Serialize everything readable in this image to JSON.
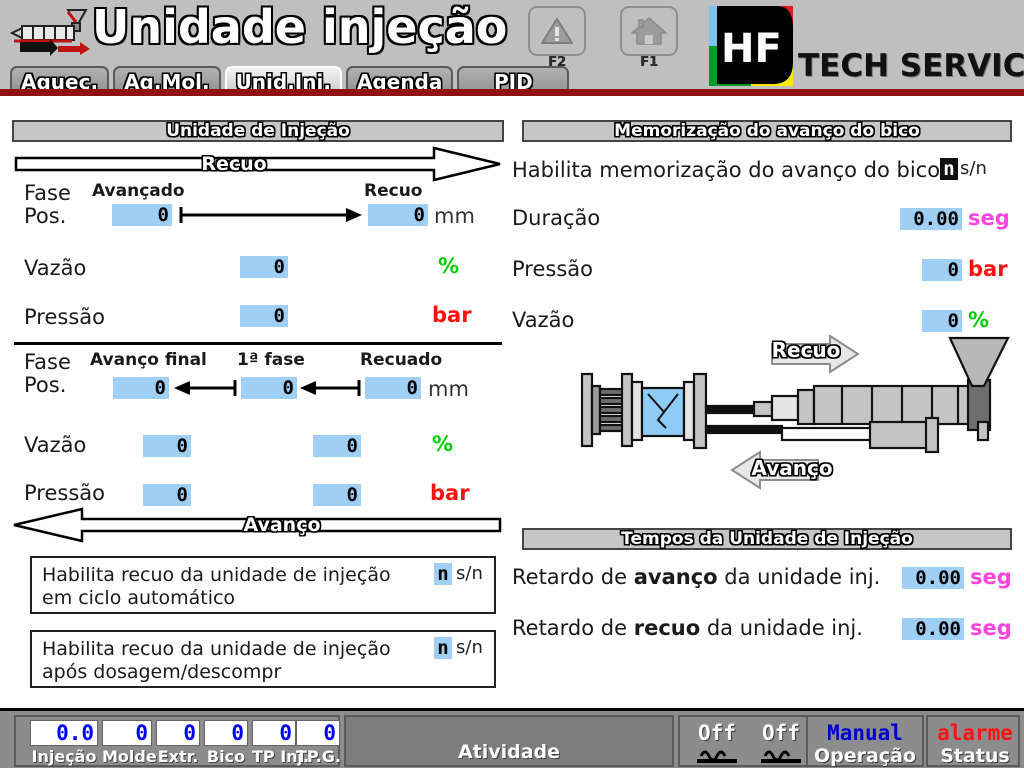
{
  "header": {
    "title": "Unidade injeção",
    "title_icon": "injection-unit-icon",
    "brand": "TECH SERVICE",
    "logo_text": "HF",
    "logo_colors": {
      "top_left": "#7fc4ef",
      "top_right": "#e01b1b",
      "bottom_left": "#0a9a2a",
      "bottom_right": "#ffe800",
      "body": "#000000"
    },
    "tabs": [
      {
        "label": "Aquec.",
        "active": false
      },
      {
        "label": "Aq.Mol.",
        "active": false
      },
      {
        "label": "Unid.Inj.",
        "active": true
      },
      {
        "label": "Agenda",
        "active": false
      },
      {
        "label": "PID",
        "active": false
      }
    ],
    "function_buttons": [
      {
        "key": "F2",
        "icon": "warning-triangle-icon"
      },
      {
        "key": "F1",
        "icon": "home-icon"
      }
    ],
    "accent_line_color": "#8f1111"
  },
  "left_panel": {
    "section_title": "Unidade de Injeção",
    "recuo_banner": "Recuo",
    "avanco_banner": "Avanço",
    "group_a": {
      "column_headers": [
        "Avançado",
        "Recuo"
      ],
      "rows": [
        {
          "label_line1": "Fase",
          "label_line2": "Pos.",
          "values": [
            "0",
            "0"
          ],
          "unit": "mm",
          "unit_kind": "mm"
        },
        {
          "label": "Vazão",
          "values": [
            "0"
          ],
          "unit": "%",
          "unit_kind": "pct"
        },
        {
          "label": "Pressão",
          "values": [
            "0"
          ],
          "unit": "bar",
          "unit_kind": "bar"
        }
      ]
    },
    "group_b": {
      "column_headers": [
        "Avanço final",
        "1ª fase",
        "Recuado"
      ],
      "rows": [
        {
          "label_line1": "Fase",
          "label_line2": "Pos.",
          "values": [
            "0",
            "0",
            "0"
          ],
          "unit": "mm",
          "unit_kind": "mm"
        },
        {
          "label": "Vazão",
          "values": [
            "0",
            "0"
          ],
          "unit": "%",
          "unit_kind": "pct"
        },
        {
          "label": "Pressão",
          "values": [
            "0",
            "0"
          ],
          "unit": "bar",
          "unit_kind": "bar"
        }
      ]
    },
    "checkboxes": [
      {
        "text": "Habilita recuo da unidade de injeção\nem ciclo automático",
        "value": "n",
        "suffix": "s/n"
      },
      {
        "text": "Habilita recuo da unidade de injeção\napós dosagem/descompr",
        "value": "n",
        "suffix": "s/n"
      }
    ]
  },
  "right_panel": {
    "memo_section": {
      "title": "Memorização do avanço do bico",
      "enable_label": "Habilita memorização do avanço do bico",
      "enable_value": "n",
      "enable_suffix": "s/n",
      "enable_focused": true,
      "rows": [
        {
          "label": "Duração",
          "value": "0.00",
          "unit": "seg",
          "unit_kind": "seg"
        },
        {
          "label": "Pressão",
          "value": "0",
          "unit": "bar",
          "unit_kind": "bar"
        },
        {
          "label": "Vazão",
          "value": "0",
          "unit": "%",
          "unit_kind": "pct"
        }
      ]
    },
    "machine_diagram": {
      "name": "injection-machine-diagram",
      "recuo_label": "Recuo",
      "avanco_label": "Avanço"
    },
    "times_section": {
      "title": "Tempos da Unidade de Injeção",
      "rows": [
        {
          "prefix": "Retardo de ",
          "bold": "avanço",
          "suffix": " da unidade inj.",
          "value": "0.00",
          "unit": "seg"
        },
        {
          "prefix": "Retardo de ",
          "bold": "recuo",
          "suffix": " da unidade inj.",
          "value": "0.00",
          "unit": "seg"
        }
      ]
    }
  },
  "status_bar": {
    "readouts": [
      {
        "value": "0.0",
        "caption": "Injeção"
      },
      {
        "value": "0",
        "caption": "Molde"
      },
      {
        "value": "0",
        "caption": "Extr."
      },
      {
        "value": "0",
        "caption": "Bico"
      },
      {
        "value": "0",
        "caption": "TP Inj."
      },
      {
        "value": "0",
        "caption": "TP.G."
      }
    ],
    "activity_label": "Atividade",
    "outputs": [
      {
        "state": "Off",
        "icon": "heater-icon"
      },
      {
        "state": "Off",
        "icon": "heater-icon"
      },
      {
        "state": "Off",
        "icon": "motor-icon"
      }
    ],
    "operation": {
      "value": "Manual",
      "caption": "Operação",
      "color": "#0000cc"
    },
    "status": {
      "value": "alarme",
      "caption": "Status",
      "color": "#ff1111"
    }
  }
}
